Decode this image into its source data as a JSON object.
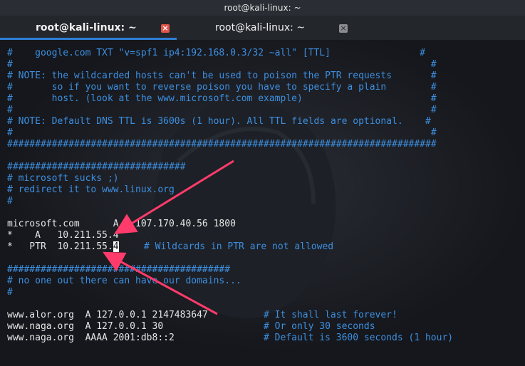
{
  "window": {
    "title": "root@kali-linux: ~"
  },
  "tabs": [
    {
      "label": "root@kali-linux: ~",
      "close": "×"
    },
    {
      "label": "root@kali-linux: ~",
      "close": "×"
    }
  ],
  "terminal": {
    "l0": "#    google.com TXT \"v=spf1 ip4:192.168.0.3/32 ~all\" [TTL]                #",
    "l1": "#                                                                           #",
    "l2": "# NOTE: the wildcarded hosts can't be used to poison the PTR requests       #",
    "l3": "#       so if you want to reverse poison you have to specify a plain        #",
    "l4": "#       host. (look at the www.microsoft.com example)                       #",
    "l5": "#                                                                           #",
    "l6": "# NOTE: Default DNS TTL is 3600s (1 hour). All TTL fields are optional.    #",
    "l7": "#                                                                           #",
    "l8": "#############################################################################",
    "l10": "################################",
    "l11": "# microsoft sucks ;)",
    "l12": "# redirect it to www.linux.org",
    "l13": "#",
    "l14": "microsoft.com      A   107.170.40.56 1800",
    "l15": "*    A   10.211.55.4",
    "l16a": "*   PTR  10.211.55.",
    "l16cursor": "4",
    "l16comment": "# Wildcards in PTR are not allowed",
    "l18": "########################################",
    "l19": "# no one out there can have our domains...",
    "l20": "#",
    "l22a": "www.alor.org  A 127.0.0.1 2147483647",
    "l22comment": "# It shall last forever!",
    "l23a": "www.naga.org  A 127.0.0.1 30",
    "l23comment": "# Or only 30 seconds",
    "l24a": "www.naga.org  AAAA 2001:db8::2",
    "l24comment": "# Default is 3600 seconds (1 hour)"
  },
  "colors": {
    "comment": "#3d8fe0",
    "text": "#e6e6e6",
    "arrow": "#ff3b6b",
    "tab_accent": "#2e7fd6",
    "close_active": "#e0554a"
  }
}
